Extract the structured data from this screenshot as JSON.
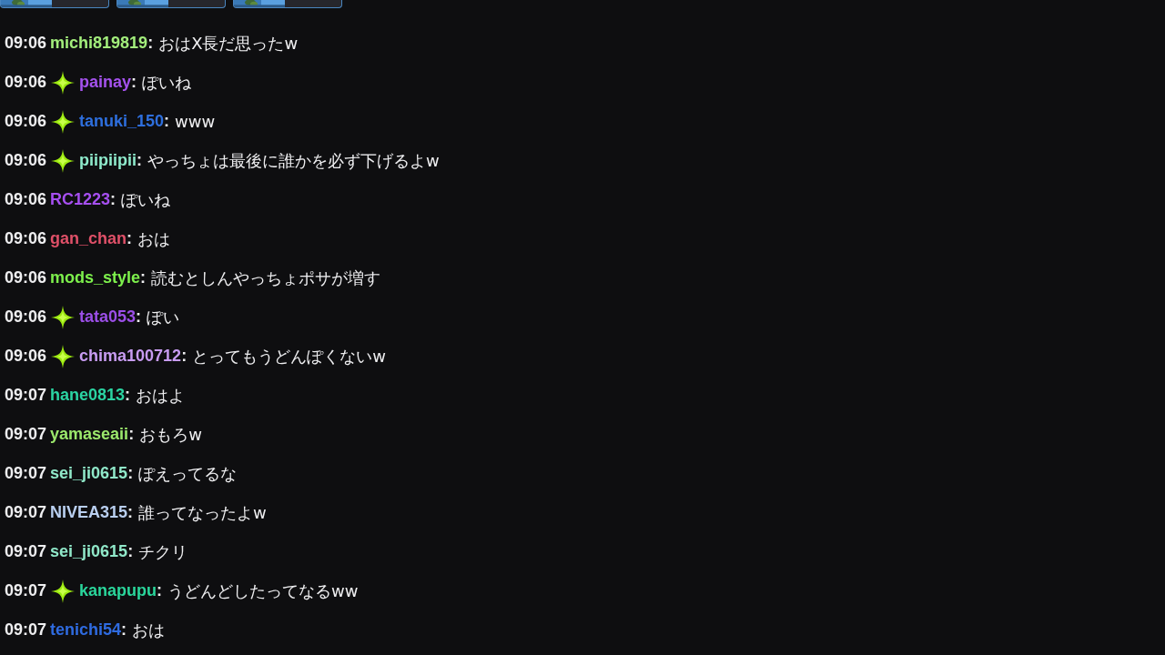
{
  "messages": [
    {
      "time": "09:06",
      "badge": false,
      "user": "michi819819",
      "color": "#a3ee7c",
      "separator": ":",
      "text": "おはX長だ思ったw"
    },
    {
      "time": "09:06",
      "badge": true,
      "user": "painay",
      "color": "#a552ee",
      "separator": ":",
      "text": "ぽいね"
    },
    {
      "time": "09:06",
      "badge": true,
      "user": "tanuki_150",
      "color": "#2e6fde",
      "separator": ":",
      "text": "www"
    },
    {
      "time": "09:06",
      "badge": true,
      "user": "piipiipii",
      "color": "#8eeacb",
      "separator": ":",
      "text": "やっちょは最後に誰かを必ず下げるよw"
    },
    {
      "time": "09:06",
      "badge": false,
      "user": "RC1223",
      "color": "#a64ff0",
      "separator": ":",
      "text": "ぽいね"
    },
    {
      "time": "09:06",
      "badge": false,
      "user": "gan_chan",
      "color": "#df5068",
      "separator": ":",
      "text": "おは"
    },
    {
      "time": "09:06",
      "badge": false,
      "user": "mods_style",
      "color": "#7df04c",
      "separator": ":",
      "text": "読むとしんやっちょポサが増す"
    },
    {
      "time": "09:06",
      "badge": true,
      "user": "tata053",
      "color": "#9c4fe8",
      "separator": ":",
      "text": "ぽい"
    },
    {
      "time": "09:06",
      "badge": true,
      "user": "chima100712",
      "color": "#c89cf2",
      "separator": ":",
      "text": "とってもうどんぽくないw"
    },
    {
      "time": "09:07",
      "badge": false,
      "user": "hane0813",
      "color": "#2bd4a2",
      "separator": ":",
      "text": "おはよ"
    },
    {
      "time": "09:07",
      "badge": false,
      "user": "yamaseaii",
      "color": "#9ce86c",
      "separator": ":",
      "text": "おもろw"
    },
    {
      "time": "09:07",
      "badge": false,
      "user": "sei_ji0615",
      "color": "#90e8c9",
      "separator": ":",
      "text": "ぽえってるな"
    },
    {
      "time": "09:07",
      "badge": false,
      "user": "NIVEA315",
      "color": "#b9cff0",
      "separator": ":",
      "text": "誰ってなったよw"
    },
    {
      "time": "09:07",
      "badge": false,
      "user": "sei_ji0615",
      "color": "#90e8c9",
      "separator": ":",
      "text": "チクリ"
    },
    {
      "time": "09:07",
      "badge": true,
      "user": "kanapupu",
      "color": "#2ad69c",
      "separator": ":",
      "text": "うどんどしたってなるww"
    },
    {
      "time": "09:07",
      "badge": false,
      "user": "tenichi54",
      "color": "#2f6be0",
      "separator": ":",
      "text": "おは"
    }
  ]
}
